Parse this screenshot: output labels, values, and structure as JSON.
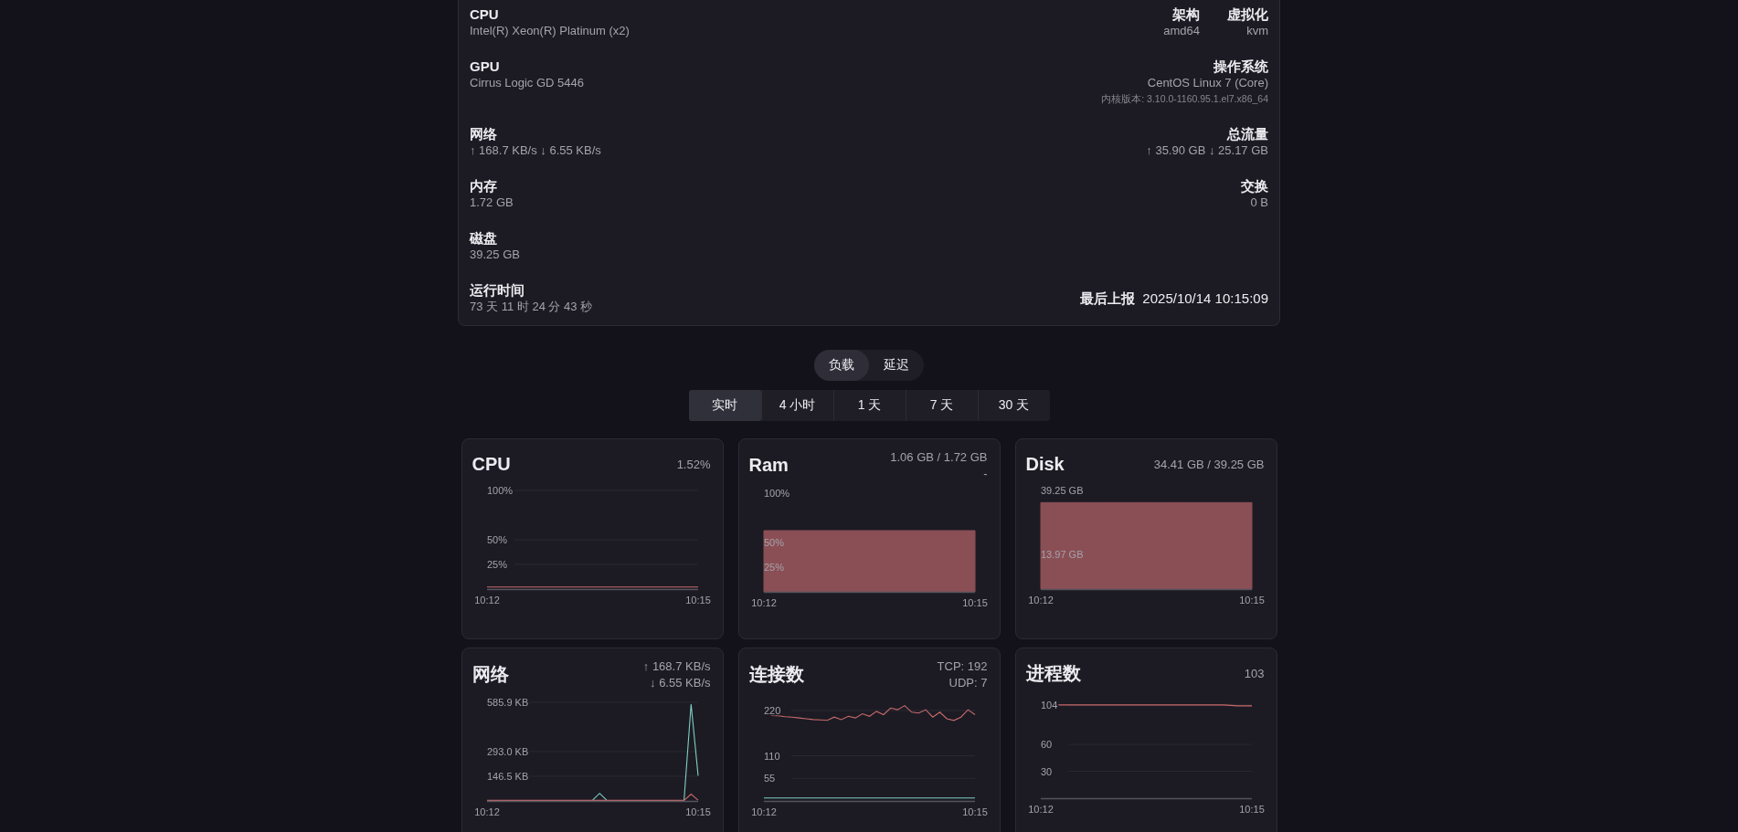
{
  "system_info": {
    "rows": [
      {
        "left": {
          "label": "CPU",
          "value": "Intel(R) Xeon(R) Platinum (x2)"
        },
        "right": [
          {
            "kind": "stacked",
            "label": "架构",
            "value": "amd64"
          },
          {
            "kind": "stacked",
            "label": "虚拟化",
            "value": "kvm"
          }
        ]
      },
      {
        "left": {
          "label": "GPU",
          "value": "Cirrus Logic GD 5446"
        },
        "right": [
          {
            "kind": "stacked",
            "label": "操作系统",
            "value": "CentOS Linux 7 (Core)",
            "note": "内核版本: 3.10.0-1160.95.1.el7.x86_64"
          }
        ]
      },
      {
        "left": {
          "label": "网络",
          "value": "↑ 168.7 KB/s ↓ 6.55 KB/s"
        },
        "right": [
          {
            "kind": "stacked",
            "label": "总流量",
            "value": "↑ 35.90 GB ↓ 25.17 GB"
          }
        ]
      },
      {
        "left": {
          "label": "内存",
          "value": "1.72 GB"
        },
        "right": [
          {
            "kind": "stacked",
            "label": "交换",
            "value": "0 B"
          }
        ]
      },
      {
        "left": {
          "label": "磁盘",
          "value": "39.25 GB"
        },
        "right": []
      },
      {
        "left": {
          "label": "运行时间",
          "value": "73 天 11 时 24 分 43 秒"
        },
        "right": [
          {
            "kind": "inline",
            "label": "最后上报",
            "value": "2025/10/14 10:15:09"
          }
        ]
      }
    ]
  },
  "view_toggle": [
    {
      "label": "负载",
      "selected": true
    },
    {
      "label": "延迟",
      "selected": false
    }
  ],
  "period_tabs": [
    {
      "label": "实时",
      "selected": true
    },
    {
      "label": "4 小时",
      "selected": false
    },
    {
      "label": "1 天",
      "selected": false
    },
    {
      "label": "7 天",
      "selected": false
    },
    {
      "label": "30 天",
      "selected": false
    }
  ],
  "charts": [
    {
      "title": "CPU",
      "values": [
        "1.52%"
      ],
      "chart_data": {
        "type": "line",
        "grid": true,
        "categories": [
          "10:12",
          null,
          null,
          null,
          null,
          null,
          null,
          null,
          null,
          null,
          null,
          null,
          null,
          null,
          null,
          "10:15"
        ],
        "ylim": [
          0,
          100
        ],
        "yticks": [
          {
            "value": 25,
            "label": "25%"
          },
          {
            "value": 50,
            "label": "50%"
          },
          {
            "value": 100,
            "label": "100%"
          }
        ],
        "series": [
          {
            "color": "#c86a6a",
            "values": [
              2,
              2,
              2,
              2,
              2,
              2,
              2,
              2,
              2,
              2,
              2,
              2,
              2,
              2,
              2,
              2
            ]
          }
        ]
      }
    },
    {
      "title": "Ram",
      "values": [
        "1.06 GB / 1.72 GB",
        "-"
      ],
      "chart_data": {
        "type": "area",
        "categories": [
          "10:12",
          null,
          null,
          null,
          null,
          null,
          null,
          null,
          null,
          null,
          null,
          null,
          null,
          null,
          null,
          "10:15"
        ],
        "ylim": [
          0,
          100
        ],
        "yticks": [
          {
            "value": 25,
            "label": "25%"
          },
          {
            "value": 50,
            "label": "50%"
          },
          {
            "value": 100,
            "label": "100%"
          }
        ],
        "series": [
          {
            "color": "#8a4f55",
            "values": [
              62,
              62,
              62,
              62,
              62,
              62,
              62,
              62,
              62,
              62,
              62,
              62,
              62,
              62,
              62,
              62
            ]
          }
        ]
      }
    },
    {
      "title": "Disk",
      "values": [
        "34.41 GB / 39.25 GB"
      ],
      "chart_data": {
        "type": "area",
        "categories": [
          "10:12",
          null,
          null,
          null,
          null,
          null,
          null,
          null,
          null,
          null,
          null,
          null,
          null,
          null,
          null,
          "10:15"
        ],
        "ylim": [
          0,
          39.25
        ],
        "yticks": [
          {
            "value": 13.97,
            "label": "13.97 GB"
          },
          {
            "value": 39.25,
            "label": "39.25 GB"
          }
        ],
        "series": [
          {
            "color": "#8a4f55",
            "values": [
              34.4,
              34.4,
              34.4,
              34.4,
              34.4,
              34.4,
              34.4,
              34.4,
              34.4,
              34.4,
              34.4,
              34.4,
              34.4,
              34.4,
              34.4,
              34.4
            ]
          }
        ]
      }
    },
    {
      "title": "网络",
      "values": [
        "↑ 168.7 KB/s",
        "↓ 6.55 KB/s"
      ],
      "chart_data": {
        "type": "line",
        "grid": true,
        "categories": [
          "10:12",
          null,
          null,
          null,
          null,
          null,
          null,
          null,
          null,
          null,
          null,
          null,
          null,
          null,
          null,
          null,
          null,
          null,
          null,
          null,
          null,
          null,
          null,
          null,
          null,
          null,
          null,
          null,
          null,
          null,
          "10:15"
        ],
        "ylim": [
          0,
          585.9
        ],
        "yticks": [
          {
            "value": 146.5,
            "label": "146.5 KB"
          },
          {
            "value": 293,
            "label": "293.0 KB"
          },
          {
            "value": 585.9,
            "label": "585.9 KB"
          }
        ],
        "series": [
          {
            "color": "#7ecfc4",
            "values": [
              null,
              null,
              null,
              null,
              null,
              null,
              null,
              null,
              null,
              null,
              null,
              null,
              null,
              null,
              null,
              5,
              45,
              5,
              null,
              null,
              null,
              null,
              null,
              null,
              null,
              null,
              null,
              null,
              5,
              575,
              150
            ]
          },
          {
            "color": "#c86a6a",
            "values": [
              3,
              3,
              3,
              3,
              3,
              3,
              3,
              3,
              3,
              3,
              3,
              3,
              3,
              3,
              3,
              3,
              3,
              3,
              3,
              3,
              3,
              3,
              3,
              3,
              3,
              3,
              3,
              3,
              3,
              40,
              5
            ]
          }
        ]
      }
    },
    {
      "title": "连接数",
      "values": [
        "TCP: 192",
        "UDP: 7"
      ],
      "chart_data": {
        "type": "line",
        "grid": true,
        "categories": [
          "10:12",
          null,
          null,
          null,
          null,
          null,
          null,
          null,
          null,
          null,
          null,
          null,
          null,
          null,
          null,
          null,
          null,
          null,
          null,
          null,
          null,
          null,
          null,
          null,
          null,
          null,
          null,
          null,
          null,
          null,
          "10:15"
        ],
        "ylim": [
          0,
          240
        ],
        "yticks": [
          {
            "value": 55,
            "label": "55"
          },
          {
            "value": 110,
            "label": "110"
          },
          {
            "value": 220,
            "label": "220"
          }
        ],
        "series": [
          {
            "color": "#c86a6a",
            "values": [
              null,
              208,
              207,
              205,
              204,
              202,
              200,
              198,
              197,
              196,
              204,
              198,
              206,
              202,
              212,
              206,
              218,
              210,
              226,
              222,
              232,
              216,
              214,
              222,
              204,
              216,
              200,
              196,
              204,
              222,
              210
            ]
          },
          {
            "color": "#7ecfc4",
            "values": [
              7,
              7,
              7,
              7,
              7,
              7,
              7,
              7,
              7,
              7,
              7,
              7,
              7,
              7,
              7,
              7,
              7,
              7,
              7,
              7,
              7,
              7,
              7,
              7,
              7,
              7,
              7,
              7,
              7,
              7,
              7
            ]
          }
        ]
      }
    },
    {
      "title": "进程数",
      "values": [
        "103"
      ],
      "chart_data": {
        "type": "line",
        "grid": true,
        "categories": [
          "10:12",
          null,
          null,
          null,
          null,
          null,
          null,
          null,
          null,
          null,
          null,
          null,
          null,
          null,
          null,
          "10:15"
        ],
        "ylim": [
          0,
          110
        ],
        "yticks": [
          {
            "value": 30,
            "label": "30"
          },
          {
            "value": 60,
            "label": "60"
          },
          {
            "value": 104,
            "label": "104"
          }
        ],
        "series": [
          {
            "color": "#c86a6a",
            "values": [
              null,
              104,
              104,
              104,
              104,
              104,
              104,
              104,
              104,
              104,
              104,
              104,
              104,
              104,
              103,
              103
            ]
          }
        ]
      }
    }
  ]
}
